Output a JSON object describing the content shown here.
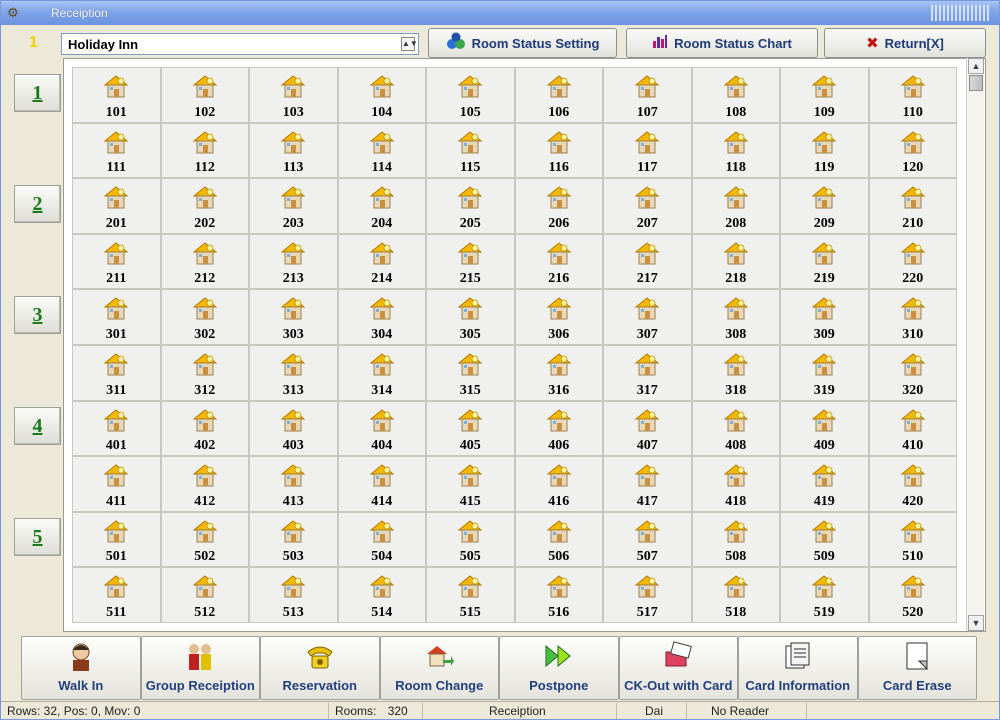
{
  "window": {
    "title": "Receiption"
  },
  "toolbar": {
    "marker": "1",
    "hotel_select": "Holiday Inn",
    "room_status_setting": "Room Status Setting",
    "room_status_chart": "Room Status Chart",
    "return": "Return[X]"
  },
  "floors": [
    "1",
    "2",
    "3",
    "4",
    "5"
  ],
  "rooms": [
    "101",
    "102",
    "103",
    "104",
    "105",
    "106",
    "107",
    "108",
    "109",
    "110",
    "111",
    "112",
    "113",
    "114",
    "115",
    "116",
    "117",
    "118",
    "119",
    "120",
    "201",
    "202",
    "203",
    "204",
    "205",
    "206",
    "207",
    "208",
    "209",
    "210",
    "211",
    "212",
    "213",
    "214",
    "215",
    "216",
    "217",
    "218",
    "219",
    "220",
    "301",
    "302",
    "303",
    "304",
    "305",
    "306",
    "307",
    "308",
    "309",
    "310",
    "311",
    "312",
    "313",
    "314",
    "315",
    "316",
    "317",
    "318",
    "319",
    "320",
    "401",
    "402",
    "403",
    "404",
    "405",
    "406",
    "407",
    "408",
    "409",
    "410",
    "411",
    "412",
    "413",
    "414",
    "415",
    "416",
    "417",
    "418",
    "419",
    "420",
    "501",
    "502",
    "503",
    "504",
    "505",
    "506",
    "507",
    "508",
    "509",
    "510",
    "511",
    "512",
    "513",
    "514",
    "515",
    "516",
    "517",
    "518",
    "519",
    "520"
  ],
  "actions": [
    {
      "label": "Walk In",
      "icon": "person-icon"
    },
    {
      "label": "Group Receiption",
      "icon": "group-icon"
    },
    {
      "label": "Reservation",
      "icon": "telephone-icon"
    },
    {
      "label": "Room Change",
      "icon": "room-change-icon"
    },
    {
      "label": "Postpone",
      "icon": "forward-arrows-icon"
    },
    {
      "label": "CK-Out with Card",
      "icon": "card-checkout-icon"
    },
    {
      "label": "Card Information",
      "icon": "card-info-icon"
    },
    {
      "label": "Card Erase",
      "icon": "card-erase-icon"
    }
  ],
  "status": {
    "rows_info": "Rows: 32, Pos: 0, Mov: 0",
    "rooms_label": "Rooms:",
    "rooms_count": "320",
    "mode": "Receiption",
    "user": "Dai",
    "reader": "No Reader"
  },
  "colors": {
    "floor_text": "#1a7a1a",
    "button_text": "#233f7e",
    "house_roof": "#f5b800"
  }
}
